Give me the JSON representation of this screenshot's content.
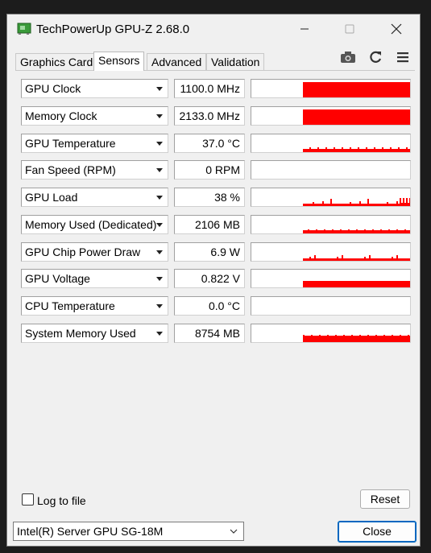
{
  "window": {
    "title": "TechPowerUp GPU-Z 2.68.0"
  },
  "tabs": [
    {
      "label": "Graphics Card",
      "active": false
    },
    {
      "label": "Sensors",
      "active": true
    },
    {
      "label": "Advanced",
      "active": false
    },
    {
      "label": "Validation",
      "active": false
    }
  ],
  "toolbar": {
    "icons": [
      "camera-icon",
      "refresh-icon",
      "menu-icon"
    ]
  },
  "sensors": [
    {
      "name": "GPU Clock",
      "value": "1100.0 MHz"
    },
    {
      "name": "Memory Clock",
      "value": "2133.0 MHz"
    },
    {
      "name": "GPU Temperature",
      "value": "37.0 °C"
    },
    {
      "name": "Fan Speed (RPM)",
      "value": "0 RPM"
    },
    {
      "name": "GPU Load",
      "value": "38 %"
    },
    {
      "name": "Memory Used (Dedicated)",
      "value": "2106 MB"
    },
    {
      "name": "GPU Chip Power Draw",
      "value": "6.9 W"
    },
    {
      "name": "GPU Voltage",
      "value": "0.822 V"
    },
    {
      "name": "CPU Temperature",
      "value": "0.0 °C"
    },
    {
      "name": "System Memory Used",
      "value": "8754 MB"
    }
  ],
  "graph_color": "#ff0000",
  "footer": {
    "log_label": "Log to file",
    "log_checked": false,
    "reset_label": "Reset",
    "gpu_selected": "Intel(R) Server GPU SG-18M",
    "close_label": "Close"
  }
}
